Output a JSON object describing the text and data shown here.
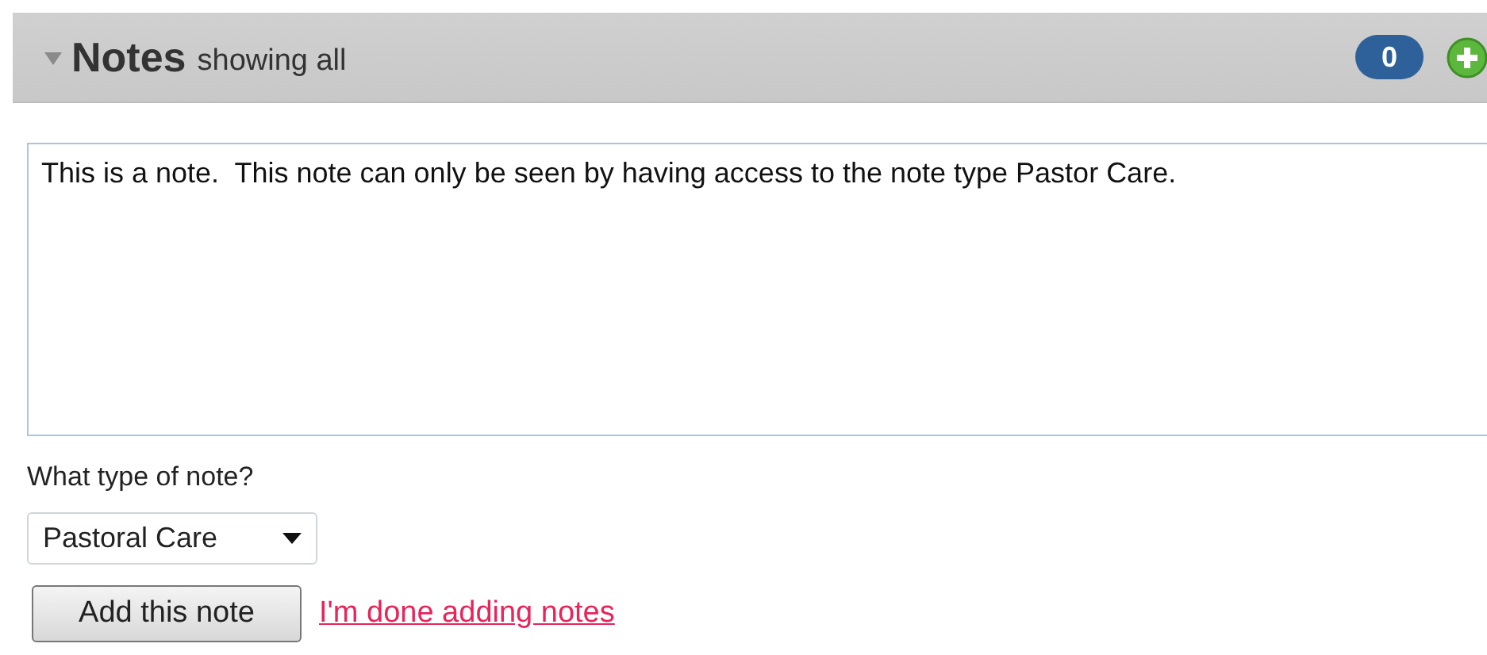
{
  "header": {
    "title": "Notes",
    "subtitle": "showing all",
    "expanded": true,
    "count": "0"
  },
  "note": {
    "value": "This is a note.  This note can only be seen by having access to the note type Pastor Care."
  },
  "type_label": "What type of note?",
  "type_select": {
    "value": "Pastoral Care"
  },
  "add_button": "Add this note",
  "done_link": "I'm done adding notes"
}
